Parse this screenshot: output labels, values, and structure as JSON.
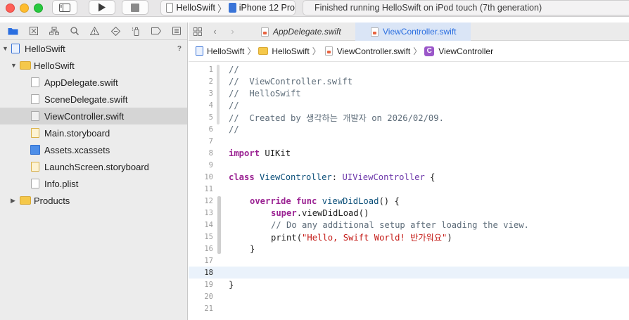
{
  "toolbar": {
    "scheme_app": "HelloSwift",
    "scheme_device": "iPhone 12 Pro",
    "status": "Finished running HelloSwift on iPod touch (7th generation)"
  },
  "navigator": {
    "project": "HelloSwift",
    "project_badge": "?",
    "group": "HelloSwift",
    "files": [
      "AppDelegate.swift",
      "SceneDelegate.swift",
      "ViewController.swift",
      "Main.storyboard",
      "Assets.xcassets",
      "LaunchScreen.storyboard",
      "Info.plist"
    ],
    "products": "Products"
  },
  "editor": {
    "tabs": [
      "AppDelegate.swift",
      "ViewController.swift"
    ],
    "jump_bar": [
      "HelloSwift",
      "HelloSwift",
      "ViewController.swift",
      "ViewController"
    ],
    "class_badge": "C",
    "code": {
      "l1": "//",
      "l2": "//  ViewController.swift",
      "l3": "//  HelloSwift",
      "l4": "//",
      "l5": "//  Created by 생각하는 개발자 on 2026/02/09.",
      "l6": "//",
      "l8_kw": "import",
      "l8_rest": " UIKit",
      "l10_kw": "class",
      "l10_name": " ViewController",
      "l10_colon": ": ",
      "l10_super": "UIViewController",
      "l10_brace": " {",
      "l12_kw": "override func",
      "l12_name": " viewDidLoad",
      "l12_rest": "() {",
      "l13_kw": "super",
      "l13_rest": ".viewDidLoad()",
      "l14": "// Do any additional setup after loading the view.",
      "l15_fn": "print",
      "l15_open": "(",
      "l15_str": "\"Hello, Swift World! 반가워요\"",
      "l15_close": ")",
      "l16": "}",
      "l19": "}"
    },
    "line_numbers": [
      "1",
      "2",
      "3",
      "4",
      "5",
      "6",
      "7",
      "8",
      "9",
      "10",
      "11",
      "12",
      "13",
      "14",
      "15",
      "16",
      "17",
      "18",
      "19",
      "20",
      "21"
    ],
    "current_line": "18"
  }
}
